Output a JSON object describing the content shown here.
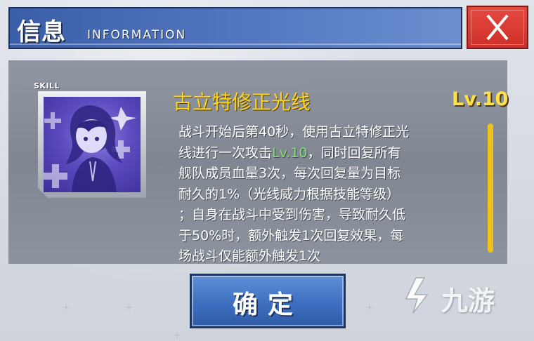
{
  "dialog": {
    "title_cn": "信息",
    "title_en": "INFORMATION",
    "close_icon": "close-icon"
  },
  "skill": {
    "tag": "SKILL",
    "icon": "skill-portrait-icon",
    "name": "古立特修正光线",
    "level": "Lv.10",
    "description_parts": {
      "p1": "战斗开始后第40秒，使用古立特修正光\n线进行一次攻击",
      "level_highlight": "Lv.10",
      "p2": "，同时回复所有\n舰队成员血量3次，每次回复量为目标\n耐久的1%（光线威力根据技能等级）\n；自身在战斗中受到伤害，导致耐久低\n于50%时，额外触发1次回复效果，每\n场战斗仅能额外触发1次"
    }
  },
  "confirm": {
    "label": "确定"
  },
  "watermark": {
    "text": "九游",
    "icon": "jiuyou-logo-icon"
  },
  "colors": {
    "header": "#4f73bd",
    "close": "#d8362e",
    "skill_name": "#ffd21a",
    "level": "#ffe14a",
    "highlight": "#7fe06a",
    "scrollbar": "#f0c21a"
  }
}
